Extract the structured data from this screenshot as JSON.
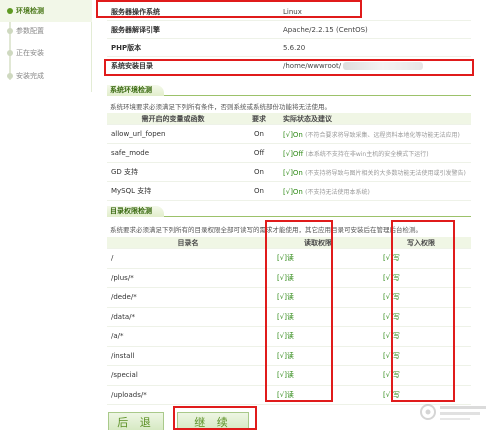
{
  "sidebar": {
    "steps": [
      {
        "label": "环境检测",
        "active": true
      },
      {
        "label": "参数配置",
        "active": false
      },
      {
        "label": "正在安装",
        "active": false
      },
      {
        "label": "安装完成",
        "active": false
      }
    ]
  },
  "server_info": [
    {
      "label": "服务器操作系统",
      "value": "Linux"
    },
    {
      "label": "服务器解译引擎",
      "value": "Apache/2.2.15 (CentOS)"
    },
    {
      "label": "PHP版本",
      "value": "5.6.20"
    },
    {
      "label": "系统安装目录",
      "value": "/home/wwwroot/"
    }
  ],
  "env": {
    "title": "系统环境检测",
    "desc": "系统环境要求必须满足下列所有条件，否则系统或系统部份功能将无法使用。",
    "headers": [
      "需开启的变量或函数",
      "要求",
      "实际状态及建议"
    ],
    "rows": [
      {
        "name": "allow_url_fopen",
        "req": "On",
        "status": "[√]On",
        "note": "(不符合要求将导致采集、远程资料本地化等功能无法应用)"
      },
      {
        "name": "safe_mode",
        "req": "Off",
        "status": "[√]Off",
        "note": "(本系统不支持在非win主机的安全模式下运行)"
      },
      {
        "name": "GD 支持",
        "req": "On",
        "status": "[√]On",
        "note": "(不支持将导致与图片相关的大多数功能无法使用或引发警告)"
      },
      {
        "name": "MySQL 支持",
        "req": "On",
        "status": "[√]On",
        "note": "(不支持无法使用本系统)"
      }
    ]
  },
  "dirs": {
    "title": "目录权限检测",
    "desc": "系统要求必须满足下列所有的目录权限全部可读写的需求才能使用，其它应用目录可安装后在管理后台检测。",
    "headers": [
      "目录名",
      "读取权限",
      "写入权限"
    ],
    "rows": [
      {
        "dir": "/",
        "read": "[√]读",
        "write": "[√]写"
      },
      {
        "dir": "/plus/*",
        "read": "[√]读",
        "write": "[√]写"
      },
      {
        "dir": "/dede/*",
        "read": "[√]读",
        "write": "[√]写"
      },
      {
        "dir": "/data/*",
        "read": "[√]读",
        "write": "[√]写"
      },
      {
        "dir": "/a/*",
        "read": "[√]读",
        "write": "[√]写"
      },
      {
        "dir": "/install",
        "read": "[√]读",
        "write": "[√]写"
      },
      {
        "dir": "/special",
        "read": "[√]读",
        "write": "[√]写"
      },
      {
        "dir": "/uploads/*",
        "read": "[√]读",
        "write": "[√]写"
      }
    ]
  },
  "buttons": {
    "back": "后 退",
    "next": "继 续"
  },
  "colors": {
    "accent": "#5f9a22",
    "annotation": "#e01b1b",
    "ok": "#2f8a16"
  }
}
